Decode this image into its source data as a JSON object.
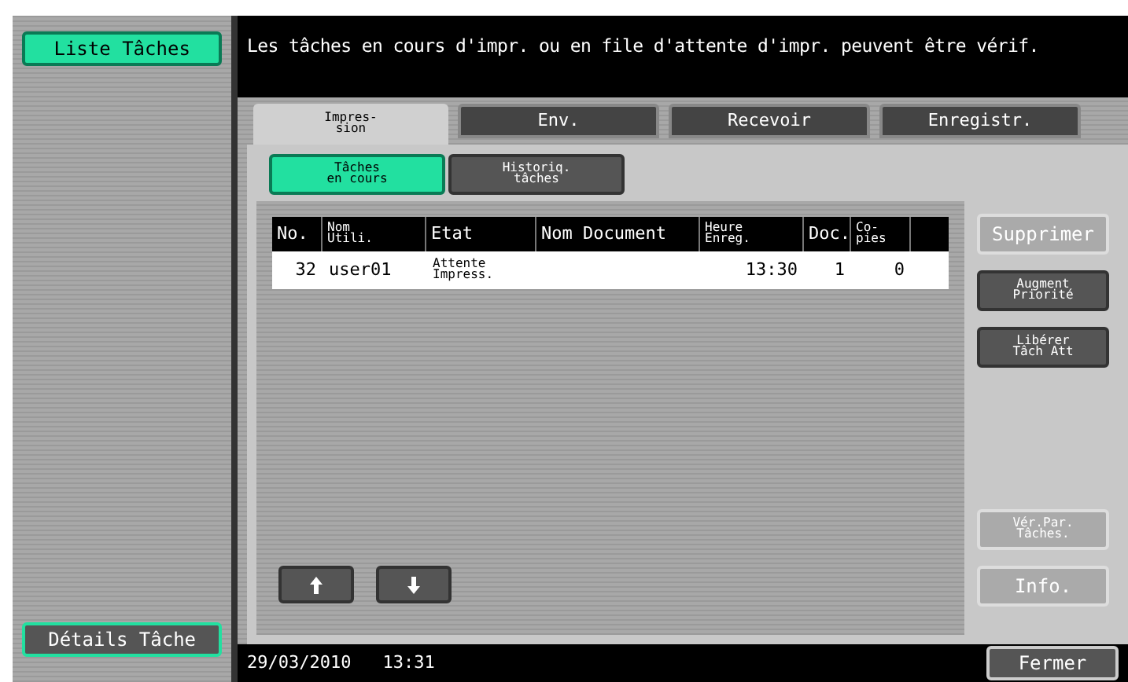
{
  "left_buttons": [
    {
      "label": "Liste Tâches",
      "selected": true
    },
    {
      "label": "Détails Tâche",
      "selected": false
    }
  ],
  "message": "Les tâches en cours d'impr. ou en file d'attente d'impr. peuvent être vérif.",
  "tabs": [
    {
      "label": "Impres-\nsion",
      "selected": true
    },
    {
      "label": "Env.",
      "selected": false
    },
    {
      "label": "Recevoir",
      "selected": false
    },
    {
      "label": "Enregistr.",
      "selected": false
    }
  ],
  "subtabs": [
    {
      "label": "Tâches\nen cours",
      "selected": true
    },
    {
      "label": "Historiq.\ntâches",
      "selected": false
    }
  ],
  "table": {
    "columns": [
      "No.",
      "Nom\nUtili.",
      "Etat",
      "Nom Document",
      "Heure\nEnreg.",
      "Doc.",
      "Co-\npies"
    ],
    "rows": [
      {
        "cells": [
          "32",
          "user01",
          "Attente\nImpress.",
          "",
          "13:30",
          "1",
          "0"
        ],
        "selected": false
      }
    ]
  },
  "side_buttons": [
    {
      "label": "Supprimer",
      "disabled": true
    },
    {
      "label": "Augment\nPriorité",
      "disabled": false
    },
    {
      "label": "Libérer\nTâch Att",
      "disabled": false
    }
  ],
  "lower_buttons": [
    {
      "label": "Vér.Par.\nTâches.",
      "disabled": true
    },
    {
      "label": "Info.",
      "disabled": true
    }
  ],
  "scroll_buttons": [
    {
      "kind": "up"
    },
    {
      "kind": "down"
    }
  ],
  "status_bar": {
    "date": "29/03/2010",
    "time": "13:31"
  },
  "close_button": "Fermer"
}
